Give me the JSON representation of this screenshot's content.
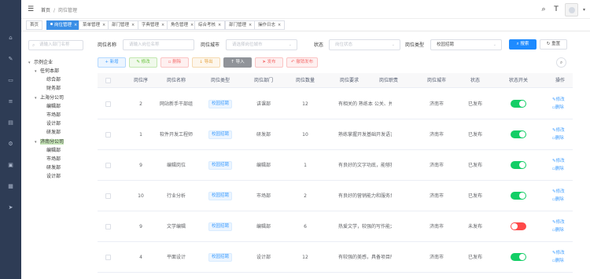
{
  "rail": {
    "icons": [
      "home-icon",
      "edit-icon",
      "chat-icon",
      "list-icon",
      "document-icon",
      "gear-icon",
      "monitor-icon",
      "briefcase-icon",
      "send-icon"
    ]
  },
  "header": {
    "breadcrumb_home": "首页",
    "breadcrumb_sep": "/",
    "breadcrumb_current": "岗位管理"
  },
  "tabs": [
    {
      "label": "首页"
    },
    {
      "label": "岗位管理",
      "active": true
    },
    {
      "label": "菜单管理"
    },
    {
      "label": "部门管理"
    },
    {
      "label": "字典管理"
    },
    {
      "label": "角色管理"
    },
    {
      "label": "综合考核"
    },
    {
      "label": "部门管理"
    },
    {
      "label": "操作日志"
    }
  ],
  "tree": {
    "search_placeholder": "请输入部门名称",
    "nodes": [
      {
        "label": "示例企业",
        "level": 0,
        "expanded": true
      },
      {
        "label": "任何本部",
        "level": 1,
        "expanded": true
      },
      {
        "label": "综合部",
        "level": 2
      },
      {
        "label": "财务部",
        "level": 2
      },
      {
        "label": "上海分公司",
        "level": 1,
        "expanded": true
      },
      {
        "label": "编辑部",
        "level": 2
      },
      {
        "label": "市场部",
        "level": 2
      },
      {
        "label": "设计部",
        "level": 2
      },
      {
        "label": "研发部",
        "level": 2
      },
      {
        "label": "济南分公司",
        "level": 1,
        "expanded": true,
        "highlighted": true
      },
      {
        "label": "编辑部",
        "level": 2
      },
      {
        "label": "市场部",
        "level": 2
      },
      {
        "label": "研发部",
        "level": 2
      },
      {
        "label": "设计部",
        "level": 2
      }
    ]
  },
  "filters": {
    "name_label": "岗位名称",
    "name_placeholder": "请输入岗位名称",
    "city_label": "岗位城市",
    "city_placeholder": "请选择岗位城市",
    "status_label": "状态",
    "status_placeholder": "岗位状态",
    "type_label": "岗位类型",
    "type_value": "校园招聘",
    "search_button": "搜索",
    "reset_button": "重置"
  },
  "toolbar": {
    "add": "新增",
    "edit": "修改",
    "delete": "删除",
    "export": "导出",
    "import": "导入",
    "publish": "发布",
    "unpublish": "撤销发布"
  },
  "table": {
    "headers": [
      "岗位序",
      "岗位名称",
      "岗位类型",
      "岗位部门",
      "岗位数量",
      "岗位要求",
      "岗位职责",
      "岗位城市",
      "状态",
      "状态开关",
      "操作"
    ],
    "op_edit": "修改",
    "op_delete": "删除",
    "rows": [
      {
        "seq": "2",
        "name": "网站新手干部组",
        "type": "校园招聘",
        "dept": "讲课部",
        "count": "12",
        "req": "有相关的  熟练本  公关、并能在编写本信息",
        "duty": "",
        "city": "济南市",
        "status": "已发布",
        "on": true
      },
      {
        "seq": "1",
        "name": "软件开发工程师",
        "type": "校园招聘",
        "dept": "研发部",
        "count": "10",
        "req": "熟练掌握开发基础开发语言和流程开发技术",
        "duty": "",
        "city": "济南市",
        "status": "已发布",
        "on": true
      },
      {
        "seq": "9",
        "name": "编辑岗位",
        "type": "校园招聘",
        "dept": "编辑部",
        "count": "1",
        "req": "有良好的文字功底，能够独立完成采访的撰",
        "duty": "",
        "city": "济南市",
        "status": "已发布",
        "on": true
      },
      {
        "seq": "10",
        "name": "行业分析",
        "type": "校园招聘",
        "dept": "市场部",
        "count": "2",
        "req": "有良好的营销能力和服务意识和创新精神",
        "duty": "",
        "city": "济南市",
        "status": "已发布",
        "on": true
      },
      {
        "seq": "9",
        "name": "文学编辑",
        "type": "校园招聘",
        "dept": "编辑部",
        "count": "6",
        "req": "热爱文学，较强的写作能力和编辑能力，熟",
        "duty": "",
        "city": "济南市",
        "status": "未发布",
        "on": false
      },
      {
        "seq": "4",
        "name": "平面设计",
        "type": "校园招聘",
        "dept": "设计部",
        "count": "12",
        "req": "有较强的美感，具备项目所需的软件技能",
        "duty": "",
        "city": "济南市",
        "status": "已发布",
        "on": true
      }
    ]
  }
}
